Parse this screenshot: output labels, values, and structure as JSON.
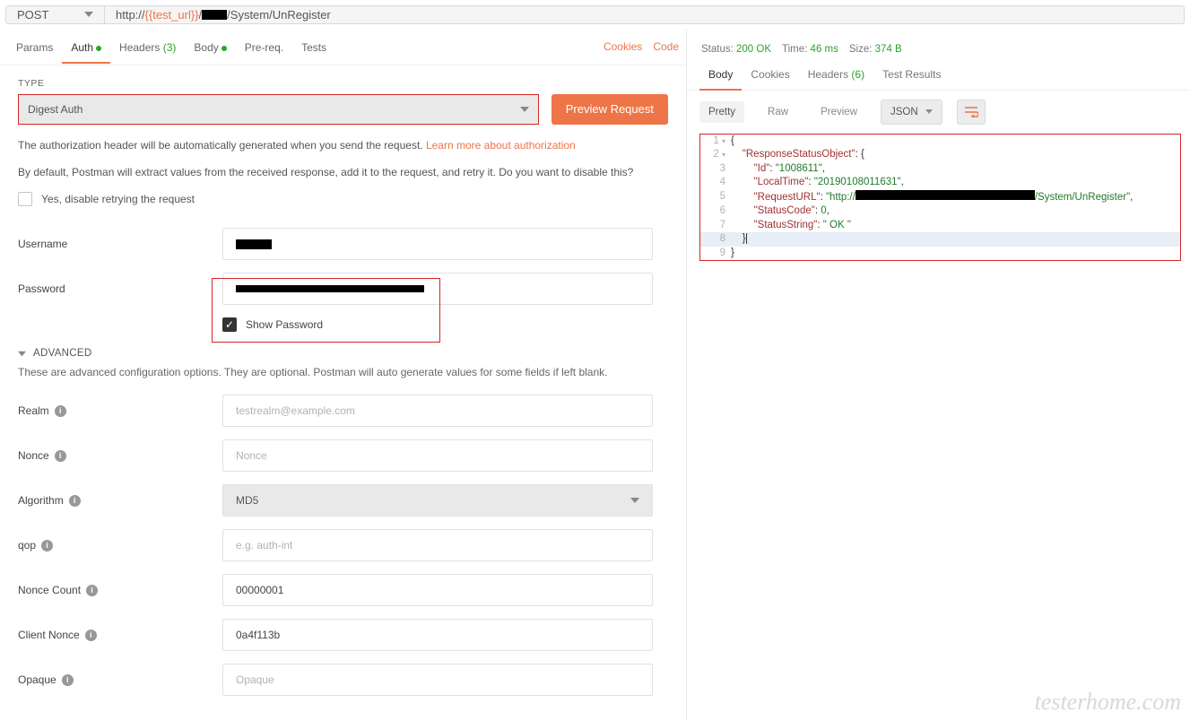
{
  "urlbar": {
    "method": "POST",
    "url_prefix": "http://",
    "url_var": "{{test_url}}",
    "url_slash": "/",
    "url_path": "/System/UnRegister"
  },
  "reqtabs": {
    "params": "Params",
    "auth": "Auth",
    "headers_label": "Headers",
    "headers_count": "(3)",
    "body": "Body",
    "prereq": "Pre-req.",
    "tests": "Tests",
    "cookies": "Cookies",
    "code": "Code"
  },
  "auth": {
    "type_label": "TYPE",
    "type_value": "Digest Auth",
    "preview": "Preview Request",
    "help1": "The authorization header will be automatically generated when you send the request. ",
    "help_link": "Learn more about authorization",
    "help2": "By default, Postman will extract values from the received response, add it to the request, and retry it. Do you want to disable this?",
    "disable": "Yes, disable retrying the request",
    "username_label": "Username",
    "password_label": "Password",
    "showpwd": "Show Password",
    "advanced": "ADVANCED",
    "adv_help": "These are advanced configuration options. They are optional. Postman will auto generate values for some fields if left blank.",
    "realm_label": "Realm",
    "realm_ph": "testrealm@example.com",
    "nonce_label": "Nonce",
    "nonce_ph": "Nonce",
    "algo_label": "Algorithm",
    "algo_value": "MD5",
    "qop_label": "qop",
    "qop_ph": "e.g. auth-int",
    "ncount_label": "Nonce Count",
    "ncount_val": "00000001",
    "cnonce_label": "Client Nonce",
    "cnonce_val": "0a4f113b",
    "opaque_label": "Opaque",
    "opaque_ph": "Opaque"
  },
  "resp": {
    "status_label": "Status:",
    "status_value": "200 OK",
    "time_label": "Time:",
    "time_value": "46 ms",
    "size_label": "Size:",
    "size_value": "374 B",
    "tab_body": "Body",
    "tab_cookies": "Cookies",
    "tab_headers": "Headers",
    "tab_headers_count": "(6)",
    "tab_testresults": "Test Results",
    "view_pretty": "Pretty",
    "view_raw": "Raw",
    "view_preview": "Preview",
    "fmt": "JSON"
  },
  "json": {
    "root_key": "\"ResponseStatusObject\"",
    "id_k": "\"Id\"",
    "id_v": "\"1008611\"",
    "lt_k": "\"LocalTime\"",
    "lt_v": "\"20190108011631\"",
    "ru_k": "\"RequestURL\"",
    "ru_pre": "\"http://",
    "ru_post": "/System/UnRegister\"",
    "sc_k": "\"StatusCode\"",
    "sc_v": "0",
    "ss_k": "\"StatusString\"",
    "ss_v": "\" OK \""
  },
  "watermark": "testerhome.com"
}
